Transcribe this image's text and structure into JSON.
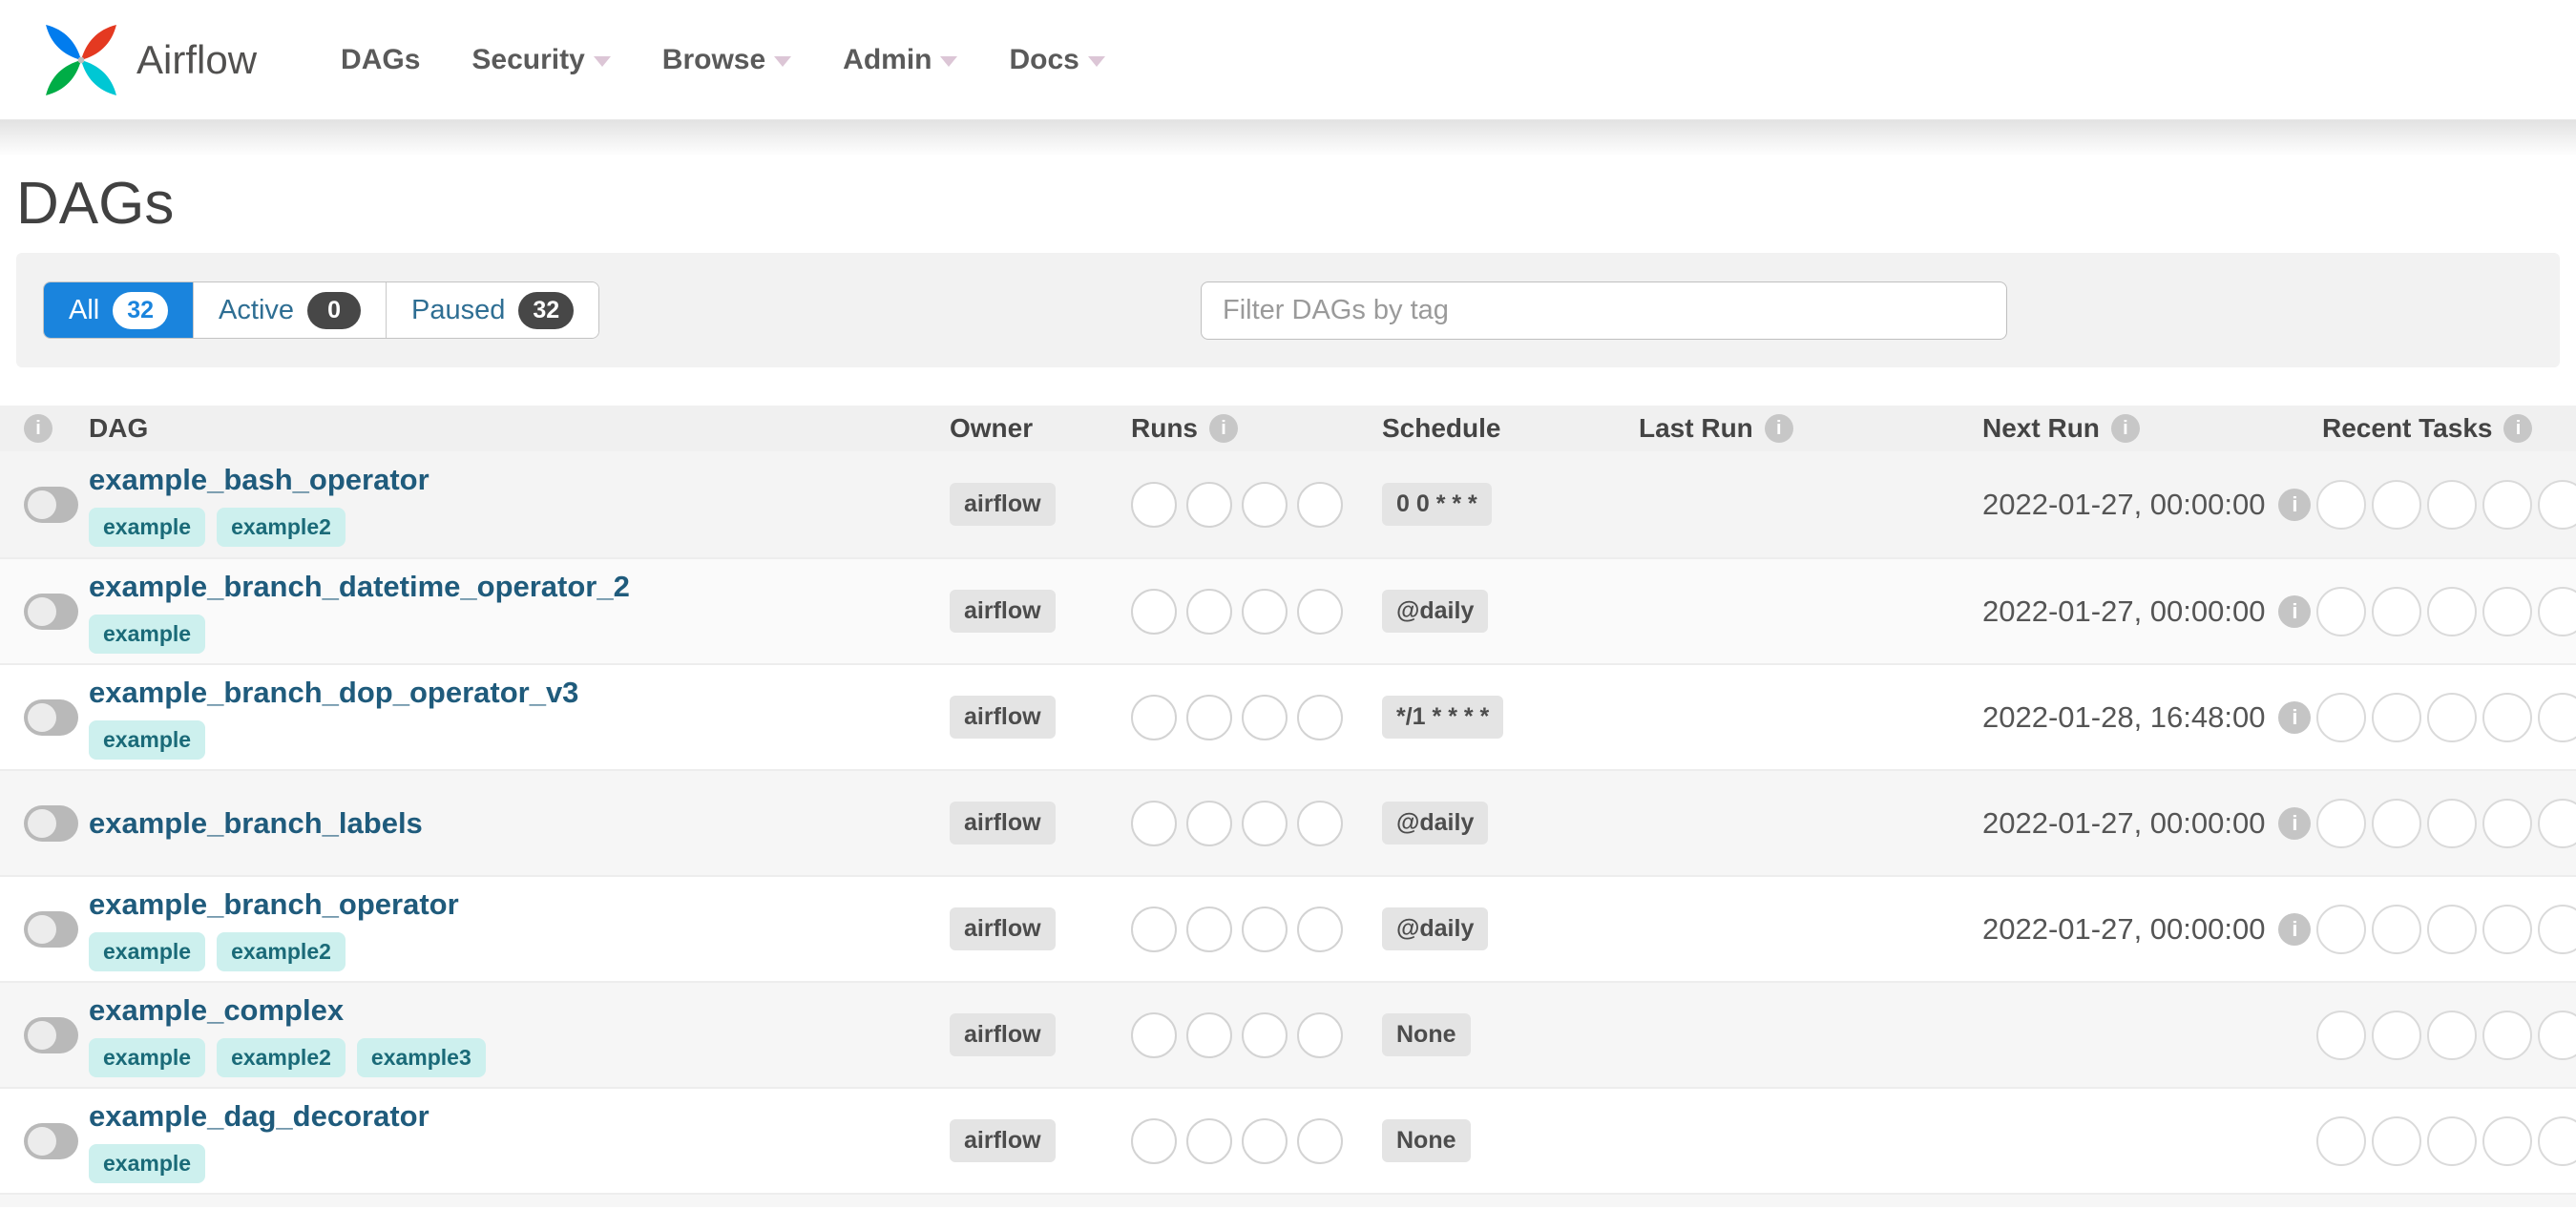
{
  "nav": {
    "brand": "Airflow",
    "items": [
      {
        "label": "DAGs",
        "has_caret": false
      },
      {
        "label": "Security",
        "has_caret": true
      },
      {
        "label": "Browse",
        "has_caret": true
      },
      {
        "label": "Admin",
        "has_caret": true
      },
      {
        "label": "Docs",
        "has_caret": true
      }
    ]
  },
  "page_title": "DAGs",
  "filter_tabs": [
    {
      "label": "All",
      "count": "32",
      "active": true
    },
    {
      "label": "Active",
      "count": "0",
      "active": false
    },
    {
      "label": "Paused",
      "count": "32",
      "active": false
    }
  ],
  "search": {
    "placeholder": "Filter DAGs by tag"
  },
  "table": {
    "columns": {
      "dag": "DAG",
      "owner": "Owner",
      "runs": "Runs",
      "schedule": "Schedule",
      "last_run": "Last Run",
      "next_run": "Next Run",
      "recent_tasks": "Recent Tasks"
    },
    "runs_circle_count": 4,
    "recent_tasks_circle_count": 5,
    "rows": [
      {
        "name": "example_bash_operator",
        "tags": [
          "example",
          "example2"
        ],
        "owner": "airflow",
        "schedule": "0 0 * * *",
        "last_run": "",
        "next_run": "2022-01-27, 00:00:00",
        "toggle_on": false
      },
      {
        "name": "example_branch_datetime_operator_2",
        "tags": [
          "example"
        ],
        "owner": "airflow",
        "schedule": "@daily",
        "last_run": "",
        "next_run": "2022-01-27, 00:00:00",
        "toggle_on": false
      },
      {
        "name": "example_branch_dop_operator_v3",
        "tags": [
          "example"
        ],
        "owner": "airflow",
        "schedule": "*/1 * * * *",
        "last_run": "",
        "next_run": "2022-01-28, 16:48:00",
        "toggle_on": false
      },
      {
        "name": "example_branch_labels",
        "tags": [],
        "owner": "airflow",
        "schedule": "@daily",
        "last_run": "",
        "next_run": "2022-01-27, 00:00:00",
        "toggle_on": false
      },
      {
        "name": "example_branch_operator",
        "tags": [
          "example",
          "example2"
        ],
        "owner": "airflow",
        "schedule": "@daily",
        "last_run": "",
        "next_run": "2022-01-27, 00:00:00",
        "toggle_on": false
      },
      {
        "name": "example_complex",
        "tags": [
          "example",
          "example2",
          "example3"
        ],
        "owner": "airflow",
        "schedule": "None",
        "last_run": "",
        "next_run": "",
        "toggle_on": false
      },
      {
        "name": "example_dag_decorator",
        "tags": [
          "example"
        ],
        "owner": "airflow",
        "schedule": "None",
        "last_run": "",
        "next_run": "",
        "toggle_on": false
      }
    ]
  },
  "colors": {
    "active_tab_blue": "#1a84dd",
    "dag_link_blue": "#1f5b7c",
    "tag_bg_teal": "#cdf0ee",
    "tag_text_teal": "#1a6a78",
    "badge_dark": "#474747",
    "logo_red": "#e43921",
    "logo_teal": "#00c7d4",
    "logo_green": "#00ad46",
    "logo_blue": "#017cee"
  }
}
